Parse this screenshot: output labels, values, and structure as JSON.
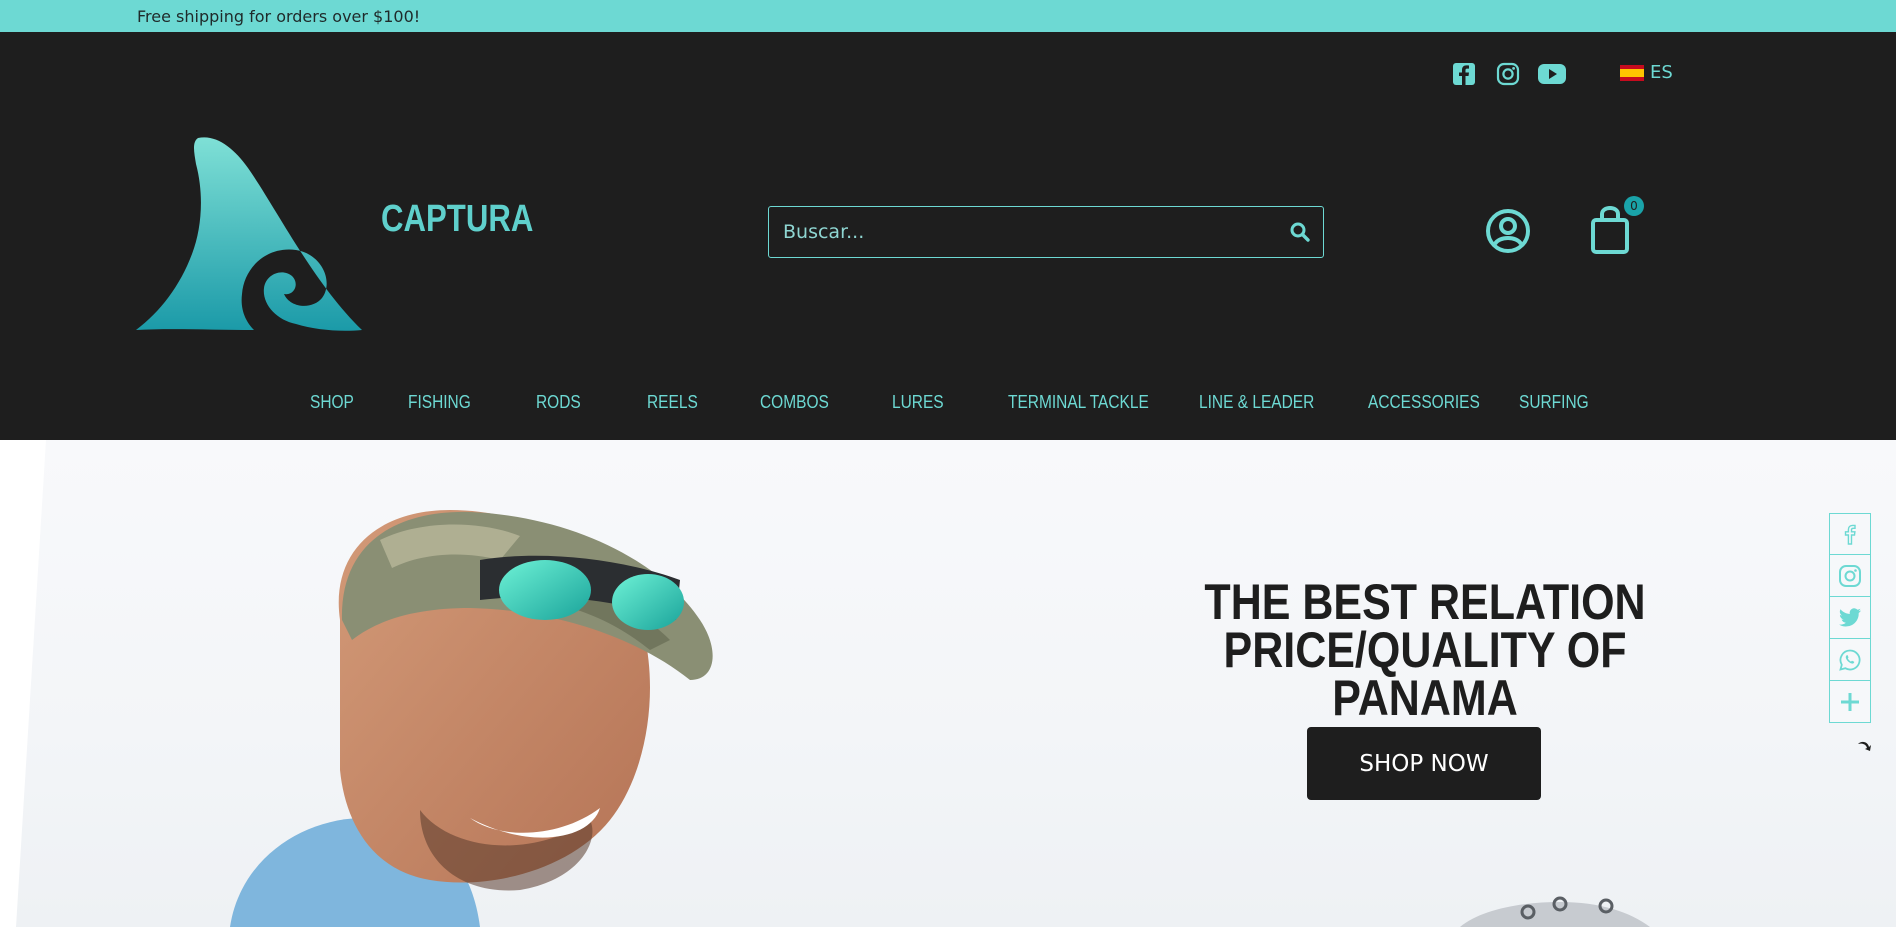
{
  "topbar": {
    "text": "Free shipping for orders over $100!"
  },
  "header": {
    "brand": "CAPTURA",
    "language": "ES",
    "social": [
      "facebook-icon",
      "instagram-icon",
      "youtube-icon"
    ],
    "search": {
      "placeholder": "Buscar..."
    },
    "cart": {
      "count": "0"
    }
  },
  "nav": {
    "items": [
      "SHOP",
      "FISHING",
      "RODS",
      "REELS",
      "COMBOS",
      "LURES",
      "TERMINAL TACKLE",
      "LINE & LEADER",
      "ACCESSORIES",
      "SURFING"
    ]
  },
  "hero": {
    "headline_line1": "THE BEST RELATION",
    "headline_line2": "PRICE/QUALITY OF PANAMA",
    "cta": "SHOP NOW"
  },
  "share": [
    "facebook-icon",
    "instagram-icon",
    "twitter-icon",
    "whatsapp-icon",
    "plus-icon"
  ],
  "colors": {
    "accent": "#6dd9d3",
    "dark": "#1e1e1e",
    "badge": "#1aa3a9"
  }
}
